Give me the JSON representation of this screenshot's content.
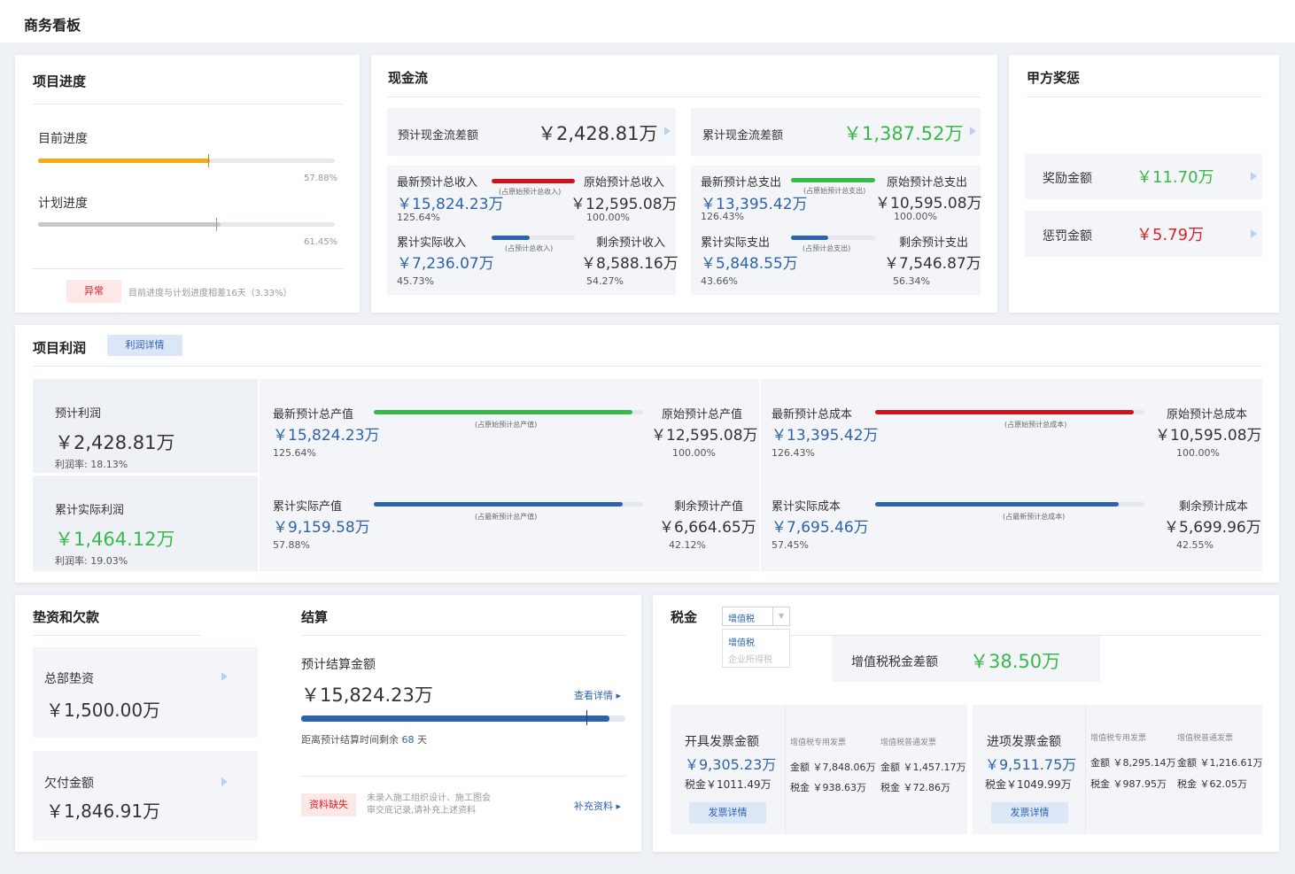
{
  "page_title": "商务看板",
  "progress": {
    "title": "项目进度",
    "current_label": "目前进度",
    "current_pct": "57.88%",
    "current_value": 0.5788,
    "plan_label": "计划进度",
    "plan_pct": "61.45%",
    "plan_value": 0.6145,
    "badge": "异常",
    "note": "目前进度与计划进度相差16天（3.33%）"
  },
  "cash": {
    "title": "现金流",
    "expected_label": "预计现金流差额",
    "expected_value": "￥2,428.81万",
    "cumulative_label": "累计现金流差额",
    "cumulative_value": "￥1,387.52万",
    "income": {
      "latest_label": "最新预计总收入",
      "latest_value": "￥15,824.23万",
      "latest_pct": "125.64%",
      "bar1_note": "(占原始预计总收入)",
      "orig_label": "原始预计总收入",
      "orig_value": "￥12,595.08万",
      "orig_pct": "100.00%",
      "actual_label": "累计实际收入",
      "actual_value": "￥7,236.07万",
      "actual_pct": "45.73%",
      "bar2_note": "(占预计总收入)",
      "remain_label": "剩余预计收入",
      "remain_value": "￥8,588.16万",
      "remain_pct": "54.27%"
    },
    "expense": {
      "latest_label": "最新预计总支出",
      "latest_value": "￥13,395.42万",
      "latest_pct": "126.43%",
      "bar1_note": "(占原始预计总支出)",
      "orig_label": "原始预计总支出",
      "orig_value": "￥10,595.08万",
      "orig_pct": "100.00%",
      "actual_label": "累计实际支出",
      "actual_value": "￥5,848.55万",
      "actual_pct": "43.66%",
      "bar2_note": "(占预计总支出)",
      "remain_label": "剩余预计支出",
      "remain_value": "￥7,546.87万",
      "remain_pct": "56.34%"
    }
  },
  "reward": {
    "title": "甲方奖惩",
    "reward_label": "奖励金额",
    "reward_value": "￥11.70万",
    "penalty_label": "惩罚金额",
    "penalty_value": "￥5.79万"
  },
  "profit": {
    "title": "项目利润",
    "detail_button": "利润详情",
    "expected_label": "预计利润",
    "expected_value": "￥2,428.81万",
    "expected_rate": "利润率: 18.13%",
    "actual_label": "累计实际利润",
    "actual_value": "￥1,464.12万",
    "actual_rate": "利润率: 19.03%",
    "output": {
      "latest_label": "最新预计总产值",
      "latest_value": "￥15,824.23万",
      "latest_pct": "125.64%",
      "note1": "(占原始预计总产值)",
      "orig_label": "原始预计总产值",
      "orig_value": "￥12,595.08万",
      "orig_pct": "100.00%",
      "actual_label": "累计实际产值",
      "actual_value": "￥9,159.58万",
      "actual_pct": "57.88%",
      "note2": "(占最新预计总产值)",
      "remain_label": "剩余预计产值",
      "remain_value": "￥6,664.65万",
      "remain_pct": "42.12%"
    },
    "cost": {
      "latest_label": "最新预计总成本",
      "latest_value": "￥13,395.42万",
      "latest_pct": "126.43%",
      "note1": "(占原始预计总成本)",
      "orig_label": "原始预计总成本",
      "orig_value": "￥10,595.08万",
      "orig_pct": "100.00%",
      "actual_label": "累计实际成本",
      "actual_value": "￥7,695.46万",
      "actual_pct": "57.45%",
      "note2": "(占最新预计总成本)",
      "remain_label": "剩余预计成本",
      "remain_value": "￥5,699.96万",
      "remain_pct": "42.55%"
    }
  },
  "advance": {
    "title": "垫资和欠款",
    "hq_label": "总部垫资",
    "hq_value": "￥1,500.00万",
    "owed_label": "欠付金额",
    "owed_value": "￥1,846.91万"
  },
  "settle": {
    "title": "结算",
    "amount_label": "预计结算金额",
    "amount_value": "￥15,824.23万",
    "view_link": "查看详情",
    "remain_prefix": "距离预计结算时间剩余",
    "remain_days": "68",
    "remain_suffix": "天",
    "badge": "资料缺失",
    "note_line1": "未录入施工组织设计、施工图会",
    "note_line2": "审交底记录,请补充上述资料",
    "supplement_link": "补充资料",
    "progress_value": 0.95
  },
  "tax": {
    "title": "税金",
    "select_value": "增值税",
    "options": [
      "增值税",
      "企业所得税"
    ],
    "diff_label": "增值税税金差额",
    "diff_value": "￥38.50万",
    "issued": {
      "label": "开具发票金额",
      "value": "￥9,305.23万",
      "tax": "税金￥1011.49万",
      "button": "发票详情",
      "col1_head": "增值税专用发票",
      "col1_amount": "金额 ￥7,848.06万",
      "col1_tax": "税金 ￥938.63万",
      "col2_head": "增值税普通发票",
      "col2_amount": "金额 ￥1,457.17万",
      "col2_tax": "税金 ￥72.86万"
    },
    "incoming": {
      "label": "进项发票金额",
      "value": "￥9,511.75万",
      "tax": "税金￥1049.99万",
      "button": "发票详情",
      "col1_head": "增值税专用发票",
      "col1_amount": "金额 ￥8,295.14万",
      "col1_tax": "税金 ￥987.95万",
      "col2_head": "增值税普通发票",
      "col2_amount": "金额 ￥1,216.61万",
      "col2_tax": "税金 ￥62.05万"
    }
  },
  "colors": {
    "accent_blue": "#2d63ad",
    "green": "#39b84a",
    "red": "#e0202a",
    "orange": "#f5a914"
  }
}
